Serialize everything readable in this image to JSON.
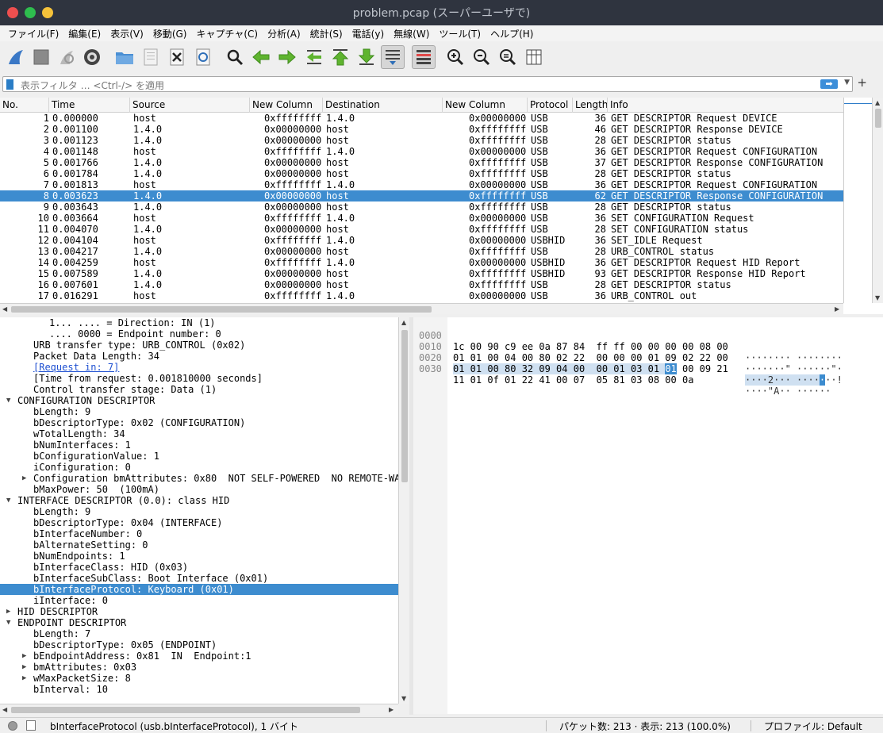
{
  "window": {
    "title": "problem.pcap (スーパーユーザで)",
    "colors": {
      "close": "#ee4f4f",
      "min": "#2ebd4e",
      "max": "#f5c23a"
    }
  },
  "menu": [
    "ファイル(F)",
    "編集(E)",
    "表示(V)",
    "移動(G)",
    "キャプチャ(C)",
    "分析(A)",
    "統計(S)",
    "電話(y)",
    "無線(W)",
    "ツール(T)",
    "ヘルプ(H)"
  ],
  "toolbar_icons": [
    "shark-fin-start-icon",
    "stop-square-icon",
    "restart-icon",
    "capture-options-gear-icon",
    "open-folder-icon",
    "save-file-icon",
    "close-file-icon",
    "reload-file-icon",
    "find-packet-icon",
    "go-back-arrow-icon",
    "go-forward-arrow-icon",
    "go-to-packet-icon",
    "first-packet-icon",
    "last-packet-icon",
    "autoscroll-icon",
    "colorize-icon",
    "zoom-in-icon",
    "zoom-out-icon",
    "zoom-normal-icon",
    "resize-columns-icon"
  ],
  "filter": {
    "placeholder": "表示フィルタ … <Ctrl-/> を適用",
    "plus": "+"
  },
  "packet_list": {
    "columns": [
      "No.",
      "Time",
      "Source",
      "New Column",
      "Destination",
      "New Column",
      "Protocol",
      "Length",
      "Info"
    ],
    "rows": [
      {
        "no": "1",
        "time": "0.000000",
        "src": "host",
        "nc1": "0xffffffff",
        "dst": "1.4.0",
        "nc2": "0x00000000",
        "proto": "USB",
        "len": "36",
        "info": "GET DESCRIPTOR Request DEVICE"
      },
      {
        "no": "2",
        "time": "0.001100",
        "src": "1.4.0",
        "nc1": "0x00000000",
        "dst": "host",
        "nc2": "0xffffffff",
        "proto": "USB",
        "len": "46",
        "info": "GET DESCRIPTOR Response DEVICE"
      },
      {
        "no": "3",
        "time": "0.001123",
        "src": "1.4.0",
        "nc1": "0x00000000",
        "dst": "host",
        "nc2": "0xffffffff",
        "proto": "USB",
        "len": "28",
        "info": "GET DESCRIPTOR status"
      },
      {
        "no": "4",
        "time": "0.001148",
        "src": "host",
        "nc1": "0xffffffff",
        "dst": "1.4.0",
        "nc2": "0x00000000",
        "proto": "USB",
        "len": "36",
        "info": "GET DESCRIPTOR Request CONFIGURATION"
      },
      {
        "no": "5",
        "time": "0.001766",
        "src": "1.4.0",
        "nc1": "0x00000000",
        "dst": "host",
        "nc2": "0xffffffff",
        "proto": "USB",
        "len": "37",
        "info": "GET DESCRIPTOR Response CONFIGURATION"
      },
      {
        "no": "6",
        "time": "0.001784",
        "src": "1.4.0",
        "nc1": "0x00000000",
        "dst": "host",
        "nc2": "0xffffffff",
        "proto": "USB",
        "len": "28",
        "info": "GET DESCRIPTOR status"
      },
      {
        "no": "7",
        "time": "0.001813",
        "src": "host",
        "nc1": "0xffffffff",
        "dst": "1.4.0",
        "nc2": "0x00000000",
        "proto": "USB",
        "len": "36",
        "info": "GET DESCRIPTOR Request CONFIGURATION"
      },
      {
        "no": "8",
        "time": "0.003623",
        "src": "1.4.0",
        "nc1": "0x00000000",
        "dst": "host",
        "nc2": "0xffffffff",
        "proto": "USB",
        "len": "62",
        "info": "GET DESCRIPTOR Response CONFIGURATION",
        "selected": true
      },
      {
        "no": "9",
        "time": "0.003643",
        "src": "1.4.0",
        "nc1": "0x00000000",
        "dst": "host",
        "nc2": "0xffffffff",
        "proto": "USB",
        "len": "28",
        "info": "GET DESCRIPTOR status"
      },
      {
        "no": "10",
        "time": "0.003664",
        "src": "host",
        "nc1": "0xffffffff",
        "dst": "1.4.0",
        "nc2": "0x00000000",
        "proto": "USB",
        "len": "36",
        "info": "SET CONFIGURATION Request"
      },
      {
        "no": "11",
        "time": "0.004070",
        "src": "1.4.0",
        "nc1": "0x00000000",
        "dst": "host",
        "nc2": "0xffffffff",
        "proto": "USB",
        "len": "28",
        "info": "SET CONFIGURATION status"
      },
      {
        "no": "12",
        "time": "0.004104",
        "src": "host",
        "nc1": "0xffffffff",
        "dst": "1.4.0",
        "nc2": "0x00000000",
        "proto": "USBHID",
        "len": "36",
        "info": "SET_IDLE Request"
      },
      {
        "no": "13",
        "time": "0.004217",
        "src": "1.4.0",
        "nc1": "0x00000000",
        "dst": "host",
        "nc2": "0xffffffff",
        "proto": "USB",
        "len": "28",
        "info": "URB_CONTROL status"
      },
      {
        "no": "14",
        "time": "0.004259",
        "src": "host",
        "nc1": "0xffffffff",
        "dst": "1.4.0",
        "nc2": "0x00000000",
        "proto": "USBHID",
        "len": "36",
        "info": "GET DESCRIPTOR Request HID Report"
      },
      {
        "no": "15",
        "time": "0.007589",
        "src": "1.4.0",
        "nc1": "0x00000000",
        "dst": "host",
        "nc2": "0xffffffff",
        "proto": "USBHID",
        "len": "93",
        "info": "GET DESCRIPTOR Response HID Report"
      },
      {
        "no": "16",
        "time": "0.007601",
        "src": "1.4.0",
        "nc1": "0x00000000",
        "dst": "host",
        "nc2": "0xffffffff",
        "proto": "USB",
        "len": "28",
        "info": "GET DESCRIPTOR status"
      },
      {
        "no": "17",
        "time": "0.016291",
        "src": "host",
        "nc1": "0xffffffff",
        "dst": "1.4.0",
        "nc2": "0x00000000",
        "proto": "USB",
        "len": "36",
        "info": "URB_CONTROL out"
      }
    ]
  },
  "details": [
    {
      "indent": 3,
      "text": "1... .... = Direction: IN (1)"
    },
    {
      "indent": 3,
      "text": ".... 0000 = Endpoint number: 0"
    },
    {
      "indent": 2,
      "text": "URB transfer type: URB_CONTROL (0x02)"
    },
    {
      "indent": 2,
      "text": "Packet Data Length: 34"
    },
    {
      "indent": 2,
      "text": "[Request in: 7]",
      "link": true
    },
    {
      "indent": 2,
      "text": "[Time from request: 0.001810000 seconds]"
    },
    {
      "indent": 2,
      "text": "Control transfer stage: Data (1)"
    },
    {
      "indent": 1,
      "text": "CONFIGURATION DESCRIPTOR",
      "arrow": "open"
    },
    {
      "indent": 2,
      "text": "bLength: 9"
    },
    {
      "indent": 2,
      "text": "bDescriptorType: 0x02 (CONFIGURATION)"
    },
    {
      "indent": 2,
      "text": "wTotalLength: 34"
    },
    {
      "indent": 2,
      "text": "bNumInterfaces: 1"
    },
    {
      "indent": 2,
      "text": "bConfigurationValue: 1"
    },
    {
      "indent": 2,
      "text": "iConfiguration: 0"
    },
    {
      "indent": 2,
      "text": "Configuration bmAttributes: 0x80  NOT SELF-POWERED  NO REMOTE-WAKEUP",
      "arrow": "closed"
    },
    {
      "indent": 2,
      "text": "bMaxPower: 50  (100mA)"
    },
    {
      "indent": 1,
      "text": "INTERFACE DESCRIPTOR (0.0): class HID",
      "arrow": "open"
    },
    {
      "indent": 2,
      "text": "bLength: 9"
    },
    {
      "indent": 2,
      "text": "bDescriptorType: 0x04 (INTERFACE)"
    },
    {
      "indent": 2,
      "text": "bInterfaceNumber: 0"
    },
    {
      "indent": 2,
      "text": "bAlternateSetting: 0"
    },
    {
      "indent": 2,
      "text": "bNumEndpoints: 1"
    },
    {
      "indent": 2,
      "text": "bInterfaceClass: HID (0x03)"
    },
    {
      "indent": 2,
      "text": "bInterfaceSubClass: Boot Interface (0x01)"
    },
    {
      "indent": 2,
      "text": "bInterfaceProtocol: Keyboard (0x01)",
      "selected": true
    },
    {
      "indent": 2,
      "text": "iInterface: 0"
    },
    {
      "indent": 1,
      "text": "HID DESCRIPTOR",
      "arrow": "closed"
    },
    {
      "indent": 1,
      "text": "ENDPOINT DESCRIPTOR",
      "arrow": "open"
    },
    {
      "indent": 2,
      "text": "bLength: 7"
    },
    {
      "indent": 2,
      "text": "bDescriptorType: 0x05 (ENDPOINT)"
    },
    {
      "indent": 2,
      "text": "bEndpointAddress: 0x81  IN  Endpoint:1",
      "arrow": "closed"
    },
    {
      "indent": 2,
      "text": "bmAttributes: 0x03",
      "arrow": "closed"
    },
    {
      "indent": 2,
      "text": "wMaxPacketSize: 8",
      "arrow": "closed"
    },
    {
      "indent": 2,
      "text": "bInterval: 10"
    }
  ],
  "bytes": [
    {
      "offset": "0000",
      "hex": "1c 00 90 c9 ee 0a 87 84  ff ff 00 00 00 00 08 00",
      "ascii": "········ ········"
    },
    {
      "offset": "0010",
      "hex": "01 01 00 04 00 80 02 22  00 00 00 01 09 02 22 00",
      "ascii": "·······\" ······\"·"
    },
    {
      "offset": "0020",
      "hex_pre": "01 01 00 80 32 09 04 00  00 01 03 01 ",
      "hex_hl": "01",
      "hex_post": " 00 09 21",
      "ascii_pre": "····2··· ····",
      "ascii_hl": "·",
      "ascii_post": "··!"
    },
    {
      "offset": "0030",
      "hex": "11 01 0f 01 22 41 00 07  05 81 03 08 00 0a",
      "ascii": "····\"A·· ······"
    }
  ],
  "status": {
    "field": "bInterfaceProtocol (usb.bInterfaceProtocol), 1 バイト",
    "packets": "パケット数: 213 · 表示: 213 (100.0%)",
    "profile": "プロファイル: Default"
  }
}
